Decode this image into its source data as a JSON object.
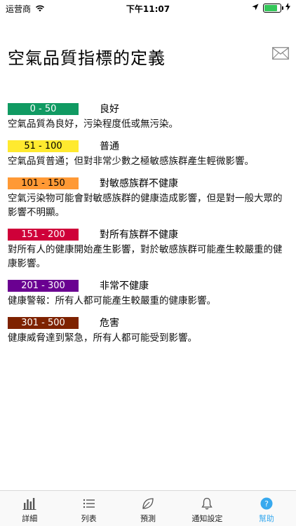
{
  "status_bar": {
    "carrier": "运营商",
    "time": "下午11:07",
    "battery_level": 0.9
  },
  "header": {
    "title": "空氣品質指標的定義",
    "mail_icon": "mail-icon"
  },
  "aqi_levels": [
    {
      "range": "0 - 50",
      "level": "良好",
      "description": "空氣品質為良好，污染程度低或無污染。",
      "color": "#109a62",
      "text_color": "#ffffff"
    },
    {
      "range": "51 - 100",
      "level": "普通",
      "description": "空氣品質普通；但對非常少數之極敏感族群產生輕微影響。",
      "color": "#ffea2f",
      "text_color": "#000000"
    },
    {
      "range": "101 - 150",
      "level": "對敏感族群不健康",
      "description": "空氣污染物可能會對敏感族群的健康造成影響，但是對一般大眾的影響不明顯。",
      "color": "#ff9935",
      "text_color": "#000000"
    },
    {
      "range": "151 - 200",
      "level": "對所有族群不健康",
      "description": "對所有人的健康開始產生影響，對於敏感族群可能產生較嚴重的健康影響。",
      "color": "#cf0039",
      "text_color": "#ffffff"
    },
    {
      "range": "201 - 300",
      "level": "非常不健康",
      "description": "健康警報：所有人都可能產生較嚴重的健康影響。",
      "color": "#6a0091",
      "text_color": "#ffffff"
    },
    {
      "range": "301 - 500",
      "level": "危害",
      "description": "健康威脅達到緊急，所有人都可能受到影響。",
      "color": "#7e2200",
      "text_color": "#ffffff"
    }
  ],
  "tabs": [
    {
      "label": "詳細",
      "icon": "bar-chart-icon"
    },
    {
      "label": "列表",
      "icon": "list-icon"
    },
    {
      "label": "預測",
      "icon": "leaf-icon"
    },
    {
      "label": "通知設定",
      "icon": "bell-icon"
    },
    {
      "label": "幫助",
      "icon": "help-icon",
      "active": true
    }
  ],
  "colors": {
    "accent": "#38a9ee"
  }
}
